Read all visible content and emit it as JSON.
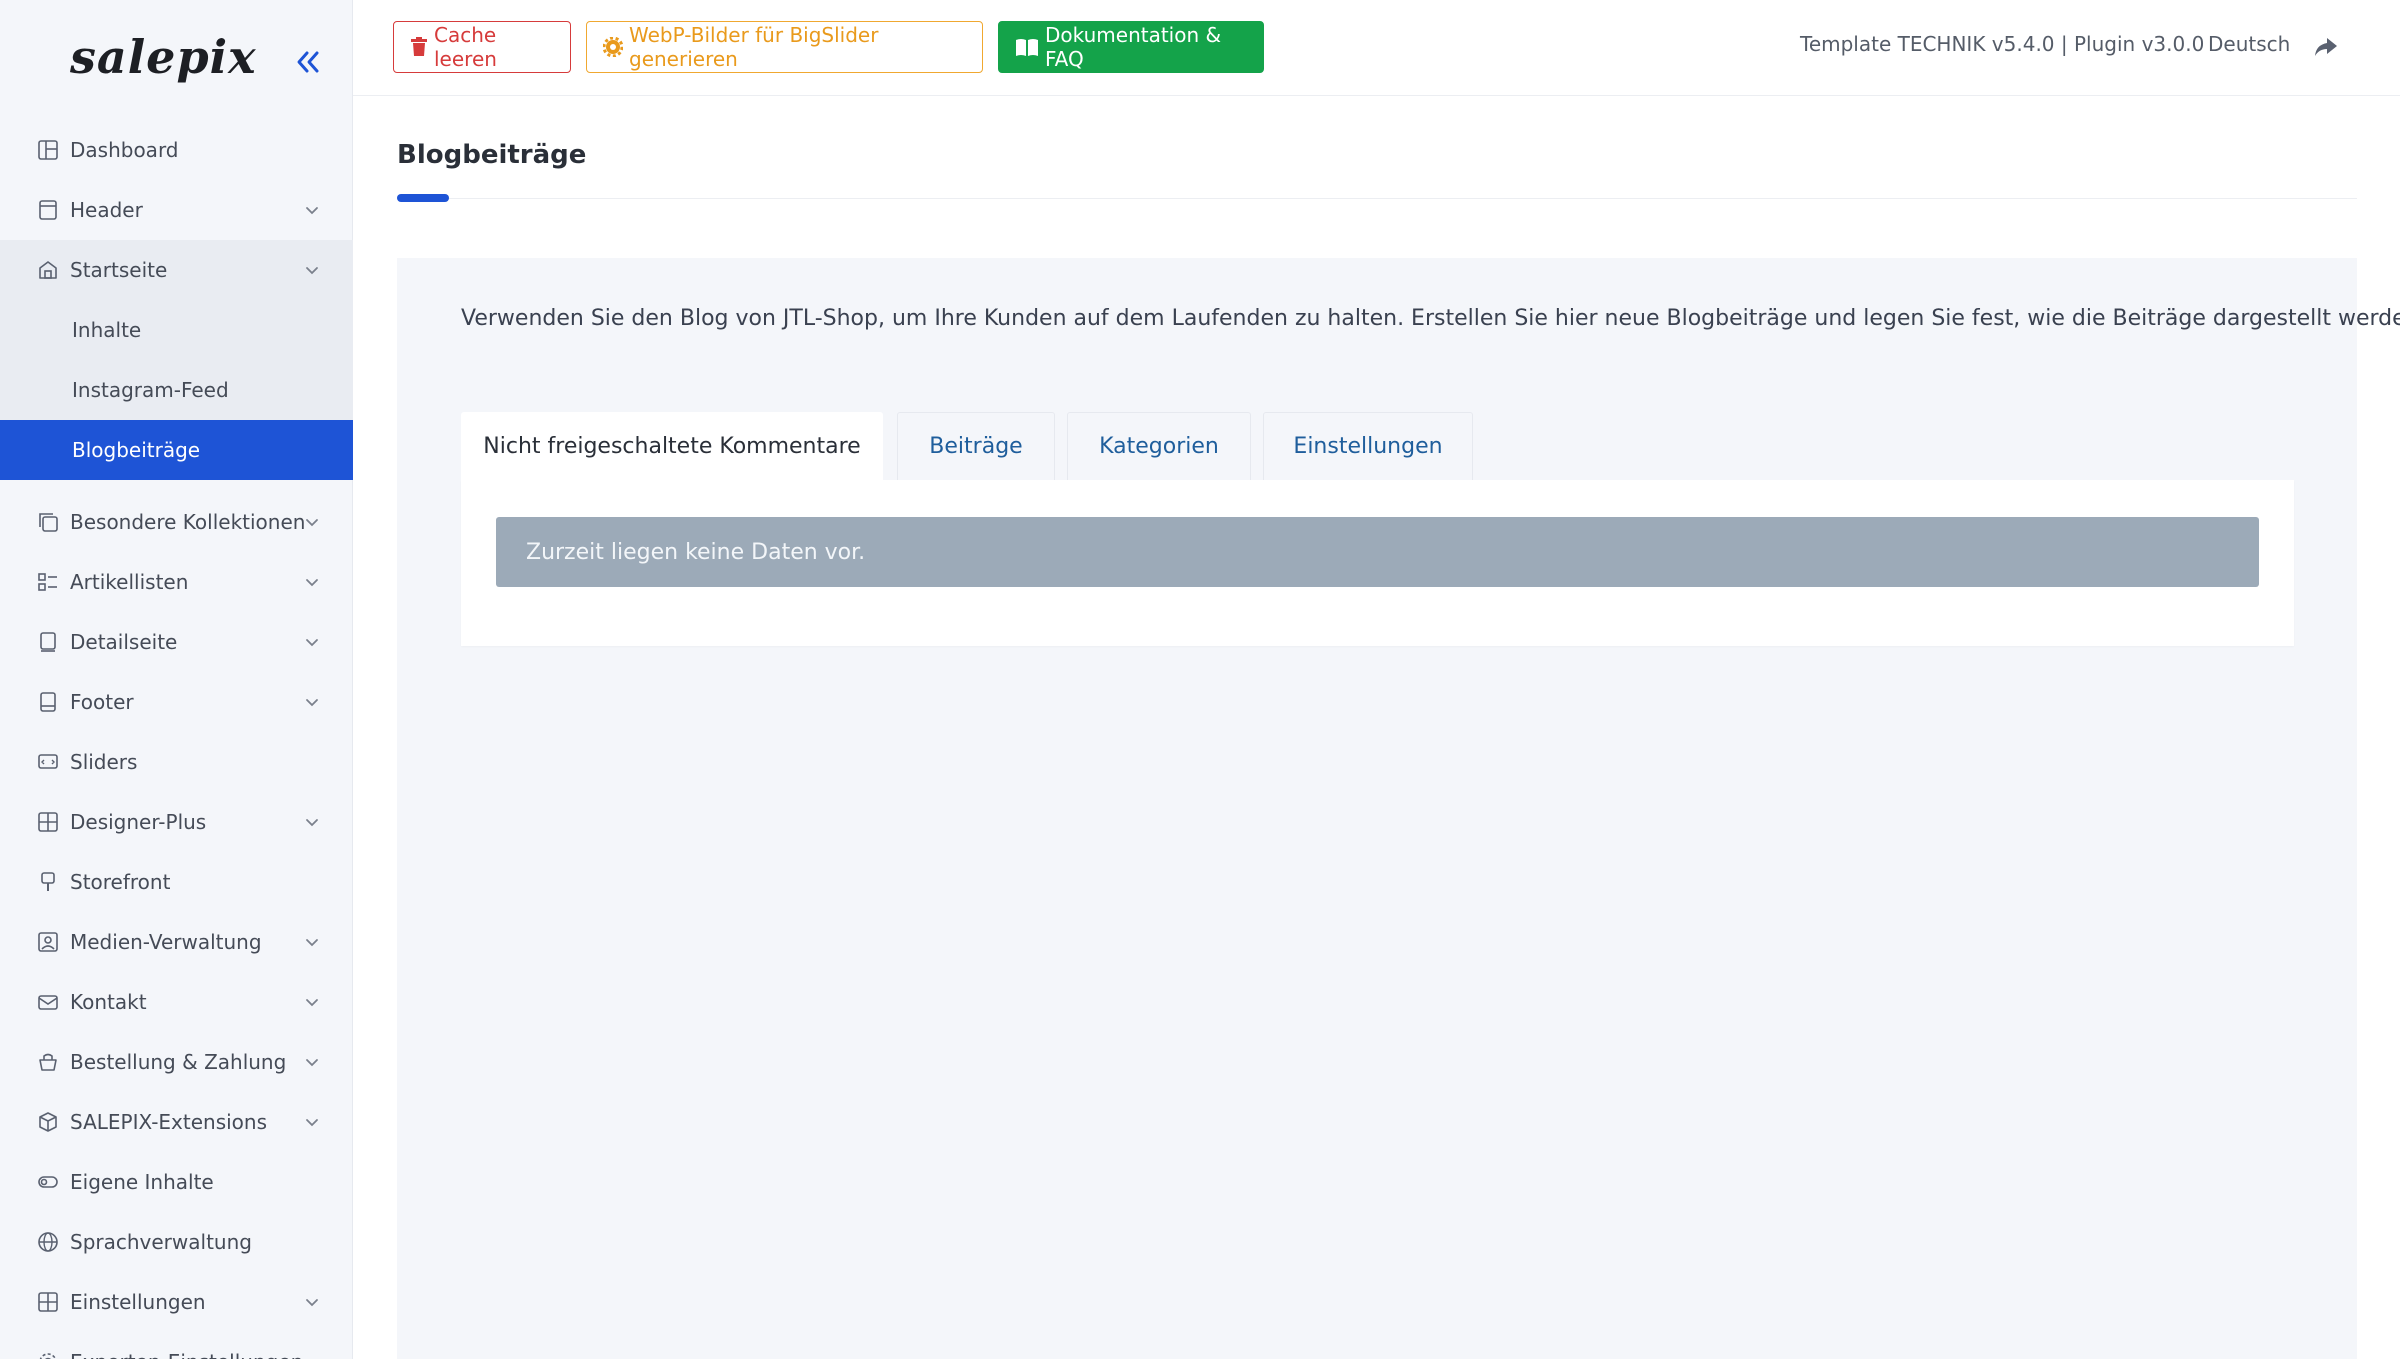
{
  "brand": {
    "logo_text": "salepix"
  },
  "colors": {
    "primary": "#1e54d6",
    "danger": "#d63b3b",
    "warning": "#e99a1c",
    "success": "#14a34a",
    "notice_bg": "#9caab8"
  },
  "sidebar": {
    "items": [
      {
        "label": "Dashboard",
        "icon": "dashboard-icon",
        "chevron": false
      },
      {
        "label": "Header",
        "icon": "header-icon",
        "chevron": true
      },
      {
        "label": "Startseite",
        "icon": "home-icon",
        "chevron": true,
        "open": true
      },
      {
        "label": "Besondere Kollektionen",
        "icon": "collections-icon",
        "chevron": true
      },
      {
        "label": "Artikellisten",
        "icon": "list-icon",
        "chevron": true
      },
      {
        "label": "Detailseite",
        "icon": "detail-icon",
        "chevron": true
      },
      {
        "label": "Footer",
        "icon": "footer-icon",
        "chevron": true
      },
      {
        "label": "Sliders",
        "icon": "slider-icon",
        "chevron": false
      },
      {
        "label": "Designer-Plus",
        "icon": "designer-icon",
        "chevron": true
      },
      {
        "label": "Storefront",
        "icon": "brush-icon",
        "chevron": false
      },
      {
        "label": "Medien-Verwaltung",
        "icon": "media-icon",
        "chevron": true
      },
      {
        "label": "Kontakt",
        "icon": "mail-icon",
        "chevron": true
      },
      {
        "label": "Bestellung & Zahlung",
        "icon": "basket-icon",
        "chevron": true
      },
      {
        "label": "SALEPIX-Extensions",
        "icon": "box-icon",
        "chevron": true
      },
      {
        "label": "Eigene Inhalte",
        "icon": "toggle-icon",
        "chevron": false
      },
      {
        "label": "Sprachverwaltung",
        "icon": "globe-icon",
        "chevron": false
      },
      {
        "label": "Einstellungen",
        "icon": "grid-icon",
        "chevron": true
      },
      {
        "label": "Experten-Einstellungen",
        "icon": "gear-icon",
        "chevron": true
      }
    ],
    "startseite_sub": [
      {
        "label": "Inhalte"
      },
      {
        "label": "Instagram-Feed"
      },
      {
        "label": "Blogbeiträge",
        "active": true
      }
    ]
  },
  "toolbar": {
    "cache_label": "Cache leeren",
    "webp_label": "WebP-Bilder für BigSlider generieren",
    "doc_label": "Dokumentation & FAQ",
    "version": "Template TECHNIK v5.4.0 | Plugin v3.0.0",
    "language": "Deutsch"
  },
  "main": {
    "title": "Blogbeiträge",
    "description": "Verwenden Sie den Blog von JTL-Shop, um Ihre Kunden auf dem Laufenden zu halten. Erstellen Sie hier neue Blogbeiträge und legen Sie fest, wie die Beiträge dargestellt werden.",
    "tabs": [
      {
        "label": "Nicht freigeschaltete Kommentare",
        "active": true
      },
      {
        "label": "Beiträge"
      },
      {
        "label": "Kategorien"
      },
      {
        "label": "Einstellungen"
      }
    ],
    "empty_notice": "Zurzeit liegen keine Daten vor."
  }
}
